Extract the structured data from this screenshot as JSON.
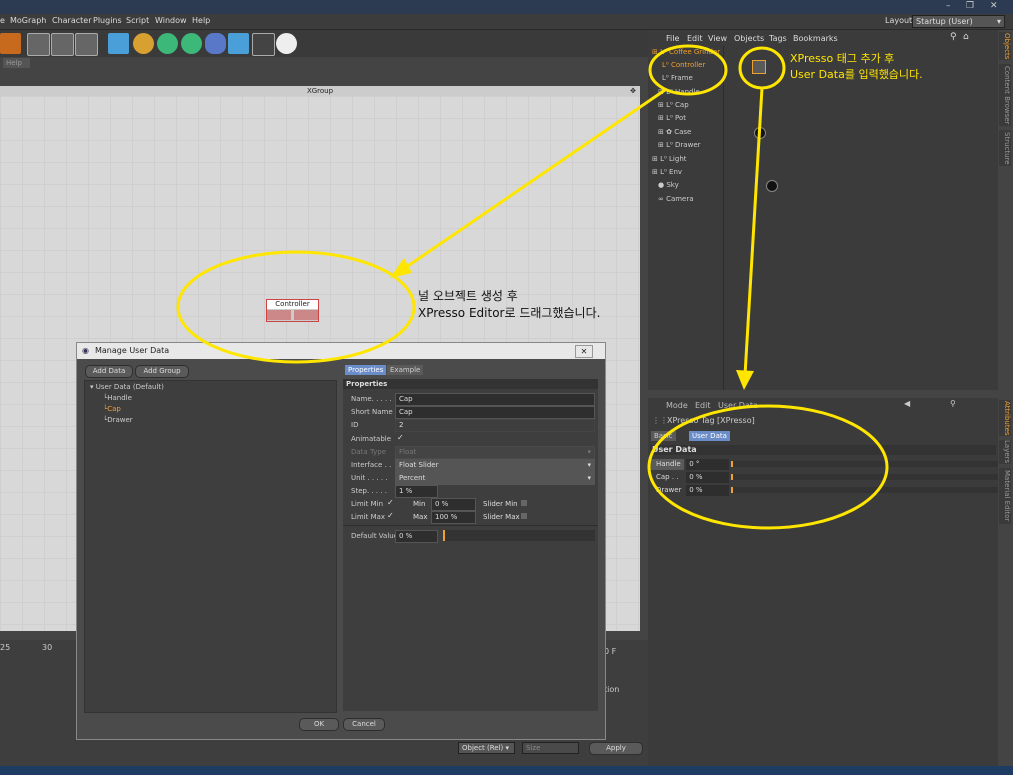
{
  "menubar": {
    "items": [
      "e",
      "MoGraph",
      "Character",
      "Plugins",
      "Script",
      "Window",
      "Help"
    ],
    "layout_label": "Layout:",
    "layout_value": "Startup (User)"
  },
  "toolbar": {
    "help_tab": "Help"
  },
  "xpresso_view": {
    "title": "XGroup",
    "node_label": "Controller"
  },
  "object_manager": {
    "menu": [
      "File",
      "Edit",
      "View",
      "Objects",
      "Tags",
      "Bookmarks"
    ],
    "objects": [
      {
        "name": "Coffee Grinder",
        "indent": 0,
        "selected": true
      },
      {
        "name": "Controller",
        "indent": 1,
        "selected": true
      },
      {
        "name": "Frame",
        "indent": 1
      },
      {
        "name": "Handle",
        "indent": 1
      },
      {
        "name": "Cap",
        "indent": 1
      },
      {
        "name": "Pot",
        "indent": 1
      },
      {
        "name": "Case",
        "indent": 1
      },
      {
        "name": "Drawer",
        "indent": 1
      },
      {
        "name": "Light",
        "indent": 0
      },
      {
        "name": "Env",
        "indent": 0
      },
      {
        "name": "Sky",
        "indent": 0
      },
      {
        "name": "Camera",
        "indent": 0
      }
    ],
    "side_tabs": [
      "Objects",
      "Content Browser",
      "Structure"
    ]
  },
  "attributes": {
    "menu": [
      "Mode",
      "Edit",
      "User Data"
    ],
    "object_title": "XPresso Tag [XPresso]",
    "tabs": [
      "Basic",
      "User Data"
    ],
    "section": "User Data",
    "rows": [
      {
        "label": "Handle",
        "value": "0 °"
      },
      {
        "label": "Cap . .",
        "value": "0 %"
      },
      {
        "label": "Drawer",
        "value": "0 %"
      }
    ],
    "side_tabs": [
      "Attributes",
      "Layers",
      "Material Editor"
    ]
  },
  "dialog": {
    "title": "Manage User Data",
    "add_data": "Add Data",
    "add_group": "Add Group",
    "tree": {
      "root": "User Data (Default)",
      "children": [
        "Handle",
        "Cap",
        "Drawer"
      ]
    },
    "tabs": [
      "Properties",
      "Example"
    ],
    "section": "Properties",
    "fields": {
      "name_label": "Name. . . . .",
      "name_value": "Cap",
      "short_name_label": "Short Name",
      "short_name_value": "Cap",
      "id_label": "ID",
      "id_value": "2",
      "animatable_label": "Animatable",
      "data_type_label": "Data Type",
      "data_type_value": "Float",
      "interface_label": "Interface . .",
      "interface_value": "Float Slider",
      "unit_label": "Unit . . . . .",
      "unit_value": "Percent",
      "step_label": "Step. . . . .",
      "step_value": "1 %",
      "limit_min_label": "Limit Min",
      "min_label": "Min",
      "min_value": "0 %",
      "slider_min_label": "Slider Min",
      "limit_max_label": "Limit Max",
      "max_label": "Max",
      "max_value": "100 %",
      "slider_max_label": "Slider Max",
      "default_value_label": "Default Value",
      "default_value_value": "0 %"
    },
    "ok": "OK",
    "cancel": "Cancel"
  },
  "bottom": {
    "ticks": [
      "25",
      "30"
    ],
    "coord_mode": "Object (Rel)",
    "size_mode": "Size",
    "apply": "Apply",
    "frame_field": "0 F",
    "position_label": "tion"
  },
  "annotations": {
    "top_right_line1": "XPresso 태그 추가 후",
    "top_right_line2": "User Data를 입력했습니다.",
    "center_line1": "널 오브젝트 생성 후",
    "center_line2": "XPresso Editor로 드래그했습니다."
  },
  "colors": {
    "accent_yellow": "#ffe600",
    "selection_orange": "#f0a030",
    "tab_active": "#6a8cc8"
  }
}
